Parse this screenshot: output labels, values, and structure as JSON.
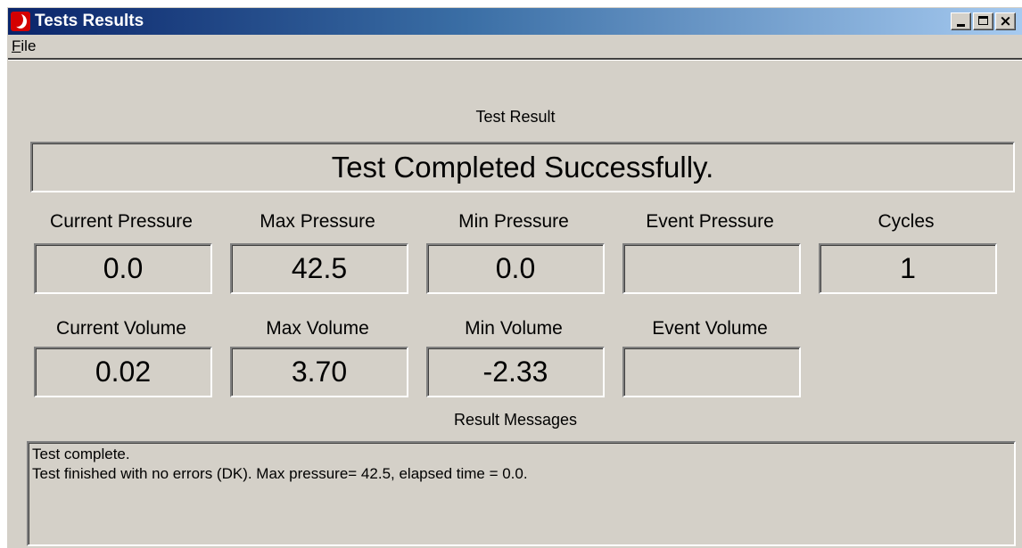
{
  "window": {
    "title": "Tests Results"
  },
  "menu": {
    "file_label": "File"
  },
  "test_result": {
    "caption": "Test Result",
    "status": "Test Completed Successfully."
  },
  "pressure": {
    "current": {
      "label": "Current Pressure",
      "value": "0.0"
    },
    "max": {
      "label": "Max Pressure",
      "value": "42.5"
    },
    "min": {
      "label": "Min Pressure",
      "value": "0.0"
    },
    "event": {
      "label": "Event Pressure",
      "value": ""
    }
  },
  "cycles": {
    "label": "Cycles",
    "value": "1"
  },
  "volume": {
    "current": {
      "label": "Current Volume",
      "value": "0.02"
    },
    "max": {
      "label": "Max Volume",
      "value": "3.70"
    },
    "min": {
      "label": "Min Volume",
      "value": "-2.33"
    },
    "event": {
      "label": "Event Volume",
      "value": ""
    }
  },
  "messages": {
    "caption": "Result Messages",
    "lines": [
      "Test complete.",
      "Test finished with no errors (DK). Max pressure= 42.5, elapsed time = 0.0."
    ]
  }
}
